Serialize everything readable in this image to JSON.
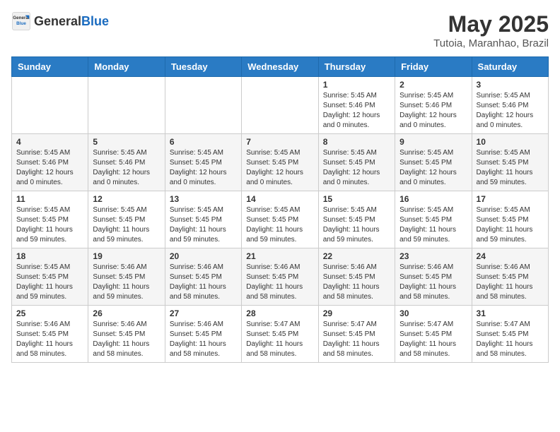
{
  "header": {
    "logo_general": "General",
    "logo_blue": "Blue",
    "title": "May 2025",
    "subtitle": "Tutoia, Maranhao, Brazil"
  },
  "calendar": {
    "days_of_week": [
      "Sunday",
      "Monday",
      "Tuesday",
      "Wednesday",
      "Thursday",
      "Friday",
      "Saturday"
    ],
    "weeks": [
      [
        {
          "day": "",
          "info": ""
        },
        {
          "day": "",
          "info": ""
        },
        {
          "day": "",
          "info": ""
        },
        {
          "day": "",
          "info": ""
        },
        {
          "day": "1",
          "info": "Sunrise: 5:45 AM\nSunset: 5:46 PM\nDaylight: 12 hours\nand 0 minutes."
        },
        {
          "day": "2",
          "info": "Sunrise: 5:45 AM\nSunset: 5:46 PM\nDaylight: 12 hours\nand 0 minutes."
        },
        {
          "day": "3",
          "info": "Sunrise: 5:45 AM\nSunset: 5:46 PM\nDaylight: 12 hours\nand 0 minutes."
        }
      ],
      [
        {
          "day": "4",
          "info": "Sunrise: 5:45 AM\nSunset: 5:46 PM\nDaylight: 12 hours\nand 0 minutes."
        },
        {
          "day": "5",
          "info": "Sunrise: 5:45 AM\nSunset: 5:46 PM\nDaylight: 12 hours\nand 0 minutes."
        },
        {
          "day": "6",
          "info": "Sunrise: 5:45 AM\nSunset: 5:45 PM\nDaylight: 12 hours\nand 0 minutes."
        },
        {
          "day": "7",
          "info": "Sunrise: 5:45 AM\nSunset: 5:45 PM\nDaylight: 12 hours\nand 0 minutes."
        },
        {
          "day": "8",
          "info": "Sunrise: 5:45 AM\nSunset: 5:45 PM\nDaylight: 12 hours\nand 0 minutes."
        },
        {
          "day": "9",
          "info": "Sunrise: 5:45 AM\nSunset: 5:45 PM\nDaylight: 12 hours\nand 0 minutes."
        },
        {
          "day": "10",
          "info": "Sunrise: 5:45 AM\nSunset: 5:45 PM\nDaylight: 11 hours\nand 59 minutes."
        }
      ],
      [
        {
          "day": "11",
          "info": "Sunrise: 5:45 AM\nSunset: 5:45 PM\nDaylight: 11 hours\nand 59 minutes."
        },
        {
          "day": "12",
          "info": "Sunrise: 5:45 AM\nSunset: 5:45 PM\nDaylight: 11 hours\nand 59 minutes."
        },
        {
          "day": "13",
          "info": "Sunrise: 5:45 AM\nSunset: 5:45 PM\nDaylight: 11 hours\nand 59 minutes."
        },
        {
          "day": "14",
          "info": "Sunrise: 5:45 AM\nSunset: 5:45 PM\nDaylight: 11 hours\nand 59 minutes."
        },
        {
          "day": "15",
          "info": "Sunrise: 5:45 AM\nSunset: 5:45 PM\nDaylight: 11 hours\nand 59 minutes."
        },
        {
          "day": "16",
          "info": "Sunrise: 5:45 AM\nSunset: 5:45 PM\nDaylight: 11 hours\nand 59 minutes."
        },
        {
          "day": "17",
          "info": "Sunrise: 5:45 AM\nSunset: 5:45 PM\nDaylight: 11 hours\nand 59 minutes."
        }
      ],
      [
        {
          "day": "18",
          "info": "Sunrise: 5:45 AM\nSunset: 5:45 PM\nDaylight: 11 hours\nand 59 minutes."
        },
        {
          "day": "19",
          "info": "Sunrise: 5:46 AM\nSunset: 5:45 PM\nDaylight: 11 hours\nand 59 minutes."
        },
        {
          "day": "20",
          "info": "Sunrise: 5:46 AM\nSunset: 5:45 PM\nDaylight: 11 hours\nand 58 minutes."
        },
        {
          "day": "21",
          "info": "Sunrise: 5:46 AM\nSunset: 5:45 PM\nDaylight: 11 hours\nand 58 minutes."
        },
        {
          "day": "22",
          "info": "Sunrise: 5:46 AM\nSunset: 5:45 PM\nDaylight: 11 hours\nand 58 minutes."
        },
        {
          "day": "23",
          "info": "Sunrise: 5:46 AM\nSunset: 5:45 PM\nDaylight: 11 hours\nand 58 minutes."
        },
        {
          "day": "24",
          "info": "Sunrise: 5:46 AM\nSunset: 5:45 PM\nDaylight: 11 hours\nand 58 minutes."
        }
      ],
      [
        {
          "day": "25",
          "info": "Sunrise: 5:46 AM\nSunset: 5:45 PM\nDaylight: 11 hours\nand 58 minutes."
        },
        {
          "day": "26",
          "info": "Sunrise: 5:46 AM\nSunset: 5:45 PM\nDaylight: 11 hours\nand 58 minutes."
        },
        {
          "day": "27",
          "info": "Sunrise: 5:46 AM\nSunset: 5:45 PM\nDaylight: 11 hours\nand 58 minutes."
        },
        {
          "day": "28",
          "info": "Sunrise: 5:47 AM\nSunset: 5:45 PM\nDaylight: 11 hours\nand 58 minutes."
        },
        {
          "day": "29",
          "info": "Sunrise: 5:47 AM\nSunset: 5:45 PM\nDaylight: 11 hours\nand 58 minutes."
        },
        {
          "day": "30",
          "info": "Sunrise: 5:47 AM\nSunset: 5:45 PM\nDaylight: 11 hours\nand 58 minutes."
        },
        {
          "day": "31",
          "info": "Sunrise: 5:47 AM\nSunset: 5:45 PM\nDaylight: 11 hours\nand 58 minutes."
        }
      ]
    ]
  }
}
